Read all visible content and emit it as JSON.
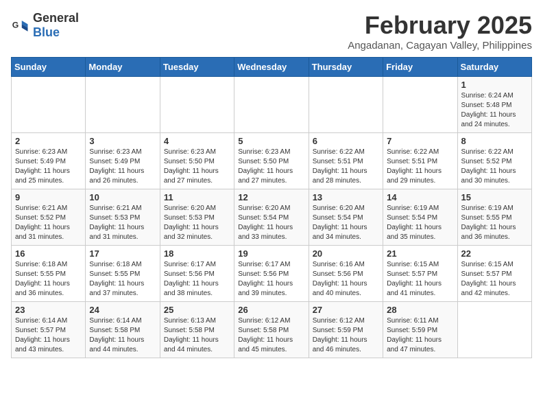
{
  "header": {
    "logo_general": "General",
    "logo_blue": "Blue",
    "month_title": "February 2025",
    "location": "Angadanan, Cagayan Valley, Philippines"
  },
  "days_of_week": [
    "Sunday",
    "Monday",
    "Tuesday",
    "Wednesday",
    "Thursday",
    "Friday",
    "Saturday"
  ],
  "weeks": [
    [
      {
        "day": "",
        "sunrise": "",
        "sunset": "",
        "daylight": ""
      },
      {
        "day": "",
        "sunrise": "",
        "sunset": "",
        "daylight": ""
      },
      {
        "day": "",
        "sunrise": "",
        "sunset": "",
        "daylight": ""
      },
      {
        "day": "",
        "sunrise": "",
        "sunset": "",
        "daylight": ""
      },
      {
        "day": "",
        "sunrise": "",
        "sunset": "",
        "daylight": ""
      },
      {
        "day": "",
        "sunrise": "",
        "sunset": "",
        "daylight": ""
      },
      {
        "day": "1",
        "sunrise": "Sunrise: 6:24 AM",
        "sunset": "Sunset: 5:48 PM",
        "daylight": "Daylight: 11 hours and 24 minutes."
      }
    ],
    [
      {
        "day": "2",
        "sunrise": "Sunrise: 6:23 AM",
        "sunset": "Sunset: 5:49 PM",
        "daylight": "Daylight: 11 hours and 25 minutes."
      },
      {
        "day": "3",
        "sunrise": "Sunrise: 6:23 AM",
        "sunset": "Sunset: 5:49 PM",
        "daylight": "Daylight: 11 hours and 26 minutes."
      },
      {
        "day": "4",
        "sunrise": "Sunrise: 6:23 AM",
        "sunset": "Sunset: 5:50 PM",
        "daylight": "Daylight: 11 hours and 27 minutes."
      },
      {
        "day": "5",
        "sunrise": "Sunrise: 6:23 AM",
        "sunset": "Sunset: 5:50 PM",
        "daylight": "Daylight: 11 hours and 27 minutes."
      },
      {
        "day": "6",
        "sunrise": "Sunrise: 6:22 AM",
        "sunset": "Sunset: 5:51 PM",
        "daylight": "Daylight: 11 hours and 28 minutes."
      },
      {
        "day": "7",
        "sunrise": "Sunrise: 6:22 AM",
        "sunset": "Sunset: 5:51 PM",
        "daylight": "Daylight: 11 hours and 29 minutes."
      },
      {
        "day": "8",
        "sunrise": "Sunrise: 6:22 AM",
        "sunset": "Sunset: 5:52 PM",
        "daylight": "Daylight: 11 hours and 30 minutes."
      }
    ],
    [
      {
        "day": "9",
        "sunrise": "Sunrise: 6:21 AM",
        "sunset": "Sunset: 5:52 PM",
        "daylight": "Daylight: 11 hours and 31 minutes."
      },
      {
        "day": "10",
        "sunrise": "Sunrise: 6:21 AM",
        "sunset": "Sunset: 5:53 PM",
        "daylight": "Daylight: 11 hours and 31 minutes."
      },
      {
        "day": "11",
        "sunrise": "Sunrise: 6:20 AM",
        "sunset": "Sunset: 5:53 PM",
        "daylight": "Daylight: 11 hours and 32 minutes."
      },
      {
        "day": "12",
        "sunrise": "Sunrise: 6:20 AM",
        "sunset": "Sunset: 5:54 PM",
        "daylight": "Daylight: 11 hours and 33 minutes."
      },
      {
        "day": "13",
        "sunrise": "Sunrise: 6:20 AM",
        "sunset": "Sunset: 5:54 PM",
        "daylight": "Daylight: 11 hours and 34 minutes."
      },
      {
        "day": "14",
        "sunrise": "Sunrise: 6:19 AM",
        "sunset": "Sunset: 5:54 PM",
        "daylight": "Daylight: 11 hours and 35 minutes."
      },
      {
        "day": "15",
        "sunrise": "Sunrise: 6:19 AM",
        "sunset": "Sunset: 5:55 PM",
        "daylight": "Daylight: 11 hours and 36 minutes."
      }
    ],
    [
      {
        "day": "16",
        "sunrise": "Sunrise: 6:18 AM",
        "sunset": "Sunset: 5:55 PM",
        "daylight": "Daylight: 11 hours and 36 minutes."
      },
      {
        "day": "17",
        "sunrise": "Sunrise: 6:18 AM",
        "sunset": "Sunset: 5:55 PM",
        "daylight": "Daylight: 11 hours and 37 minutes."
      },
      {
        "day": "18",
        "sunrise": "Sunrise: 6:17 AM",
        "sunset": "Sunset: 5:56 PM",
        "daylight": "Daylight: 11 hours and 38 minutes."
      },
      {
        "day": "19",
        "sunrise": "Sunrise: 6:17 AM",
        "sunset": "Sunset: 5:56 PM",
        "daylight": "Daylight: 11 hours and 39 minutes."
      },
      {
        "day": "20",
        "sunrise": "Sunrise: 6:16 AM",
        "sunset": "Sunset: 5:56 PM",
        "daylight": "Daylight: 11 hours and 40 minutes."
      },
      {
        "day": "21",
        "sunrise": "Sunrise: 6:15 AM",
        "sunset": "Sunset: 5:57 PM",
        "daylight": "Daylight: 11 hours and 41 minutes."
      },
      {
        "day": "22",
        "sunrise": "Sunrise: 6:15 AM",
        "sunset": "Sunset: 5:57 PM",
        "daylight": "Daylight: 11 hours and 42 minutes."
      }
    ],
    [
      {
        "day": "23",
        "sunrise": "Sunrise: 6:14 AM",
        "sunset": "Sunset: 5:57 PM",
        "daylight": "Daylight: 11 hours and 43 minutes."
      },
      {
        "day": "24",
        "sunrise": "Sunrise: 6:14 AM",
        "sunset": "Sunset: 5:58 PM",
        "daylight": "Daylight: 11 hours and 44 minutes."
      },
      {
        "day": "25",
        "sunrise": "Sunrise: 6:13 AM",
        "sunset": "Sunset: 5:58 PM",
        "daylight": "Daylight: 11 hours and 44 minutes."
      },
      {
        "day": "26",
        "sunrise": "Sunrise: 6:12 AM",
        "sunset": "Sunset: 5:58 PM",
        "daylight": "Daylight: 11 hours and 45 minutes."
      },
      {
        "day": "27",
        "sunrise": "Sunrise: 6:12 AM",
        "sunset": "Sunset: 5:59 PM",
        "daylight": "Daylight: 11 hours and 46 minutes."
      },
      {
        "day": "28",
        "sunrise": "Sunrise: 6:11 AM",
        "sunset": "Sunset: 5:59 PM",
        "daylight": "Daylight: 11 hours and 47 minutes."
      },
      {
        "day": "",
        "sunrise": "",
        "sunset": "",
        "daylight": ""
      }
    ]
  ]
}
